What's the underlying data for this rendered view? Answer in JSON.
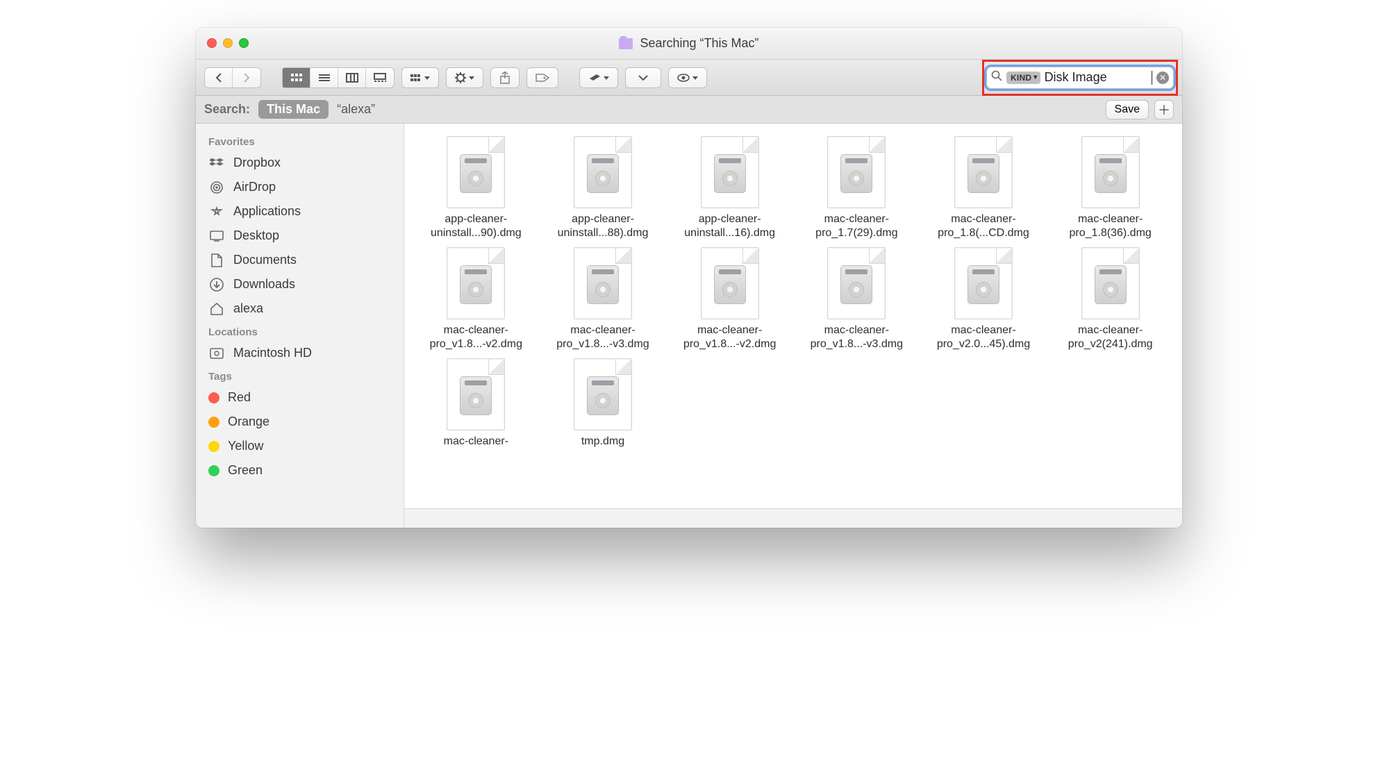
{
  "window": {
    "title": "Searching “This Mac”"
  },
  "search": {
    "kind_label": "KIND",
    "text": "Disk Image"
  },
  "scope": {
    "label": "Search:",
    "active": "This Mac",
    "alt": "“alexa”",
    "save": "Save"
  },
  "sidebar": {
    "favorites_header": "Favorites",
    "favorites": [
      {
        "key": "dropbox",
        "label": "Dropbox"
      },
      {
        "key": "airdrop",
        "label": "AirDrop"
      },
      {
        "key": "applications",
        "label": "Applications"
      },
      {
        "key": "desktop",
        "label": "Desktop"
      },
      {
        "key": "documents",
        "label": "Documents"
      },
      {
        "key": "downloads",
        "label": "Downloads"
      },
      {
        "key": "alexa",
        "label": "alexa"
      }
    ],
    "locations_header": "Locations",
    "locations": [
      {
        "key": "macintosh-hd",
        "label": "Macintosh HD"
      }
    ],
    "tags_header": "Tags",
    "tags": [
      {
        "key": "red",
        "label": "Red",
        "color": "#ff5b51"
      },
      {
        "key": "orange",
        "label": "Orange",
        "color": "#ff9f0a"
      },
      {
        "key": "yellow",
        "label": "Yellow",
        "color": "#ffd60a"
      },
      {
        "key": "green",
        "label": "Green",
        "color": "#30d158"
      }
    ]
  },
  "files": [
    {
      "line1": "app-cleaner-",
      "line2": "uninstall...90).dmg"
    },
    {
      "line1": "app-cleaner-",
      "line2": "uninstall...88).dmg"
    },
    {
      "line1": "app-cleaner-",
      "line2": "uninstall...16).dmg"
    },
    {
      "line1": "mac-cleaner-",
      "line2": "pro_1.7(29).dmg"
    },
    {
      "line1": "mac-cleaner-",
      "line2": "pro_1.8(...CD.dmg"
    },
    {
      "line1": "mac-cleaner-",
      "line2": "pro_1.8(36).dmg"
    },
    {
      "line1": "mac-cleaner-",
      "line2": "pro_v1.8...-v2.dmg"
    },
    {
      "line1": "mac-cleaner-",
      "line2": "pro_v1.8...-v3.dmg"
    },
    {
      "line1": "mac-cleaner-",
      "line2": "pro_v1.8...-v2.dmg"
    },
    {
      "line1": "mac-cleaner-",
      "line2": "pro_v1.8...-v3.dmg"
    },
    {
      "line1": "mac-cleaner-",
      "line2": "pro_v2.0...45).dmg"
    },
    {
      "line1": "mac-cleaner-",
      "line2": "pro_v2(241).dmg"
    },
    {
      "line1": "mac-cleaner-",
      "line2": ""
    },
    {
      "line1": "tmp.dmg",
      "line2": ""
    }
  ]
}
